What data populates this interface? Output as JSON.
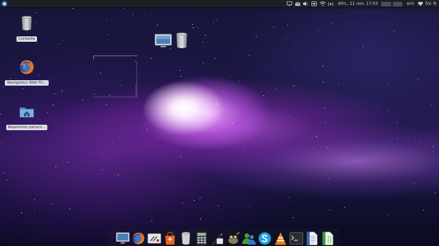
{
  "top_panel": {
    "clock": "dim., 11 nov.  17:03",
    "user": "eric",
    "keyboard_layout": "SV: N",
    "tray_icons": [
      "monitor-icon",
      "mail-icon",
      "volume-icon",
      "notification-icon",
      "wifi-icon",
      "network-activity-icon"
    ]
  },
  "desktop": {
    "icons": [
      {
        "name": "trash-icon",
        "label": "Corbeille"
      },
      {
        "name": "firefox-icon",
        "label": "Navigateur Web Fir..."
      },
      {
        "name": "home-folder-icon",
        "label": "Répertoire person..."
      }
    ]
  },
  "dock": {
    "items": [
      "monitor-icon",
      "firefox-icon",
      "settings-tools-icon",
      "software-center-icon",
      "trash-icon",
      "calculator-icon",
      "text-editor-icon",
      "gimp-icon",
      "contacts-icon",
      "skype-icon",
      "vlc-icon",
      "terminal-icon",
      "document-icon",
      "spreadsheet-icon"
    ]
  },
  "colors": {
    "panel_bg": "#1c1f26",
    "wallpaper_purple": "#b45ae6",
    "label_bg": "#ebeef2"
  }
}
